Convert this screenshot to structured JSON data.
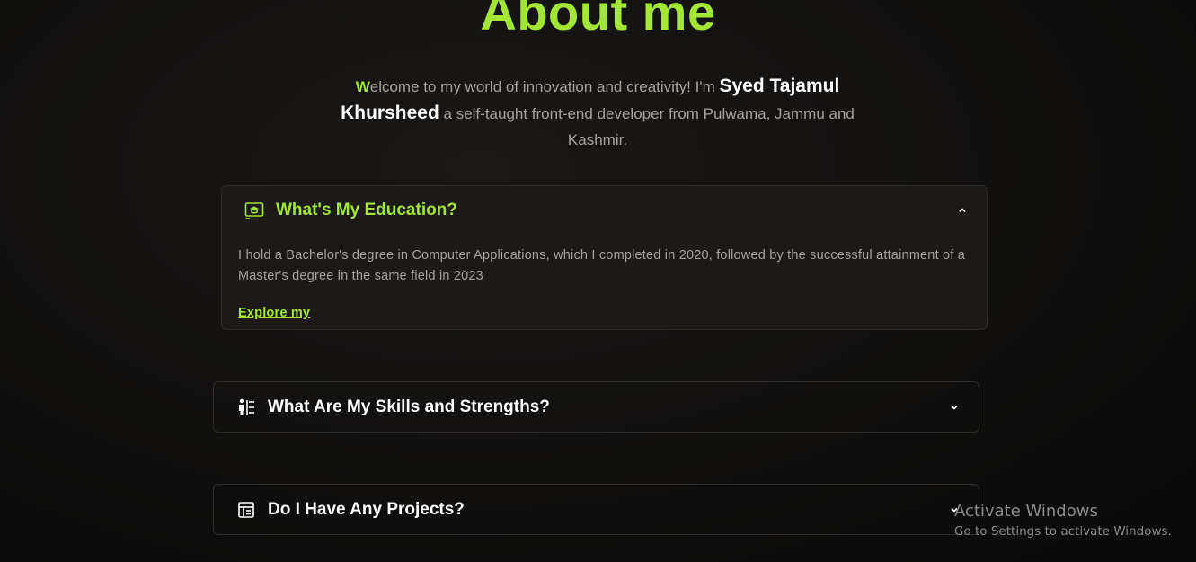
{
  "about": {
    "title": "About me",
    "intro_first_letter": "W",
    "intro_before_name": "elcome to my world of innovation and creativity! I'm ",
    "name": "Syed Tajamul Khursheed",
    "intro_after_name": " a self-taught front-end developer from Pulwama, Jammu and Kashmir."
  },
  "accordions": [
    {
      "title": "What's My Education?",
      "icon": "graduation-icon",
      "expanded": true,
      "body": "I hold a Bachelor's degree in Computer Applications, which I completed in 2020, followed by the successful attainment of a Master's degree in the same field in 2023",
      "link": "Explore my"
    },
    {
      "title": "What Are My Skills and Strengths?",
      "icon": "skills-icon",
      "expanded": false
    },
    {
      "title": "Do I Have Any Projects?",
      "icon": "projects-icon",
      "expanded": false
    }
  ],
  "watermark": {
    "title": "Activate Windows",
    "subtitle": "Go to Settings to activate Windows."
  },
  "colors": {
    "accent": "#a3e635",
    "text_muted": "#a8a29e",
    "card_bg": "#1c1917",
    "border": "#2e2b28"
  }
}
